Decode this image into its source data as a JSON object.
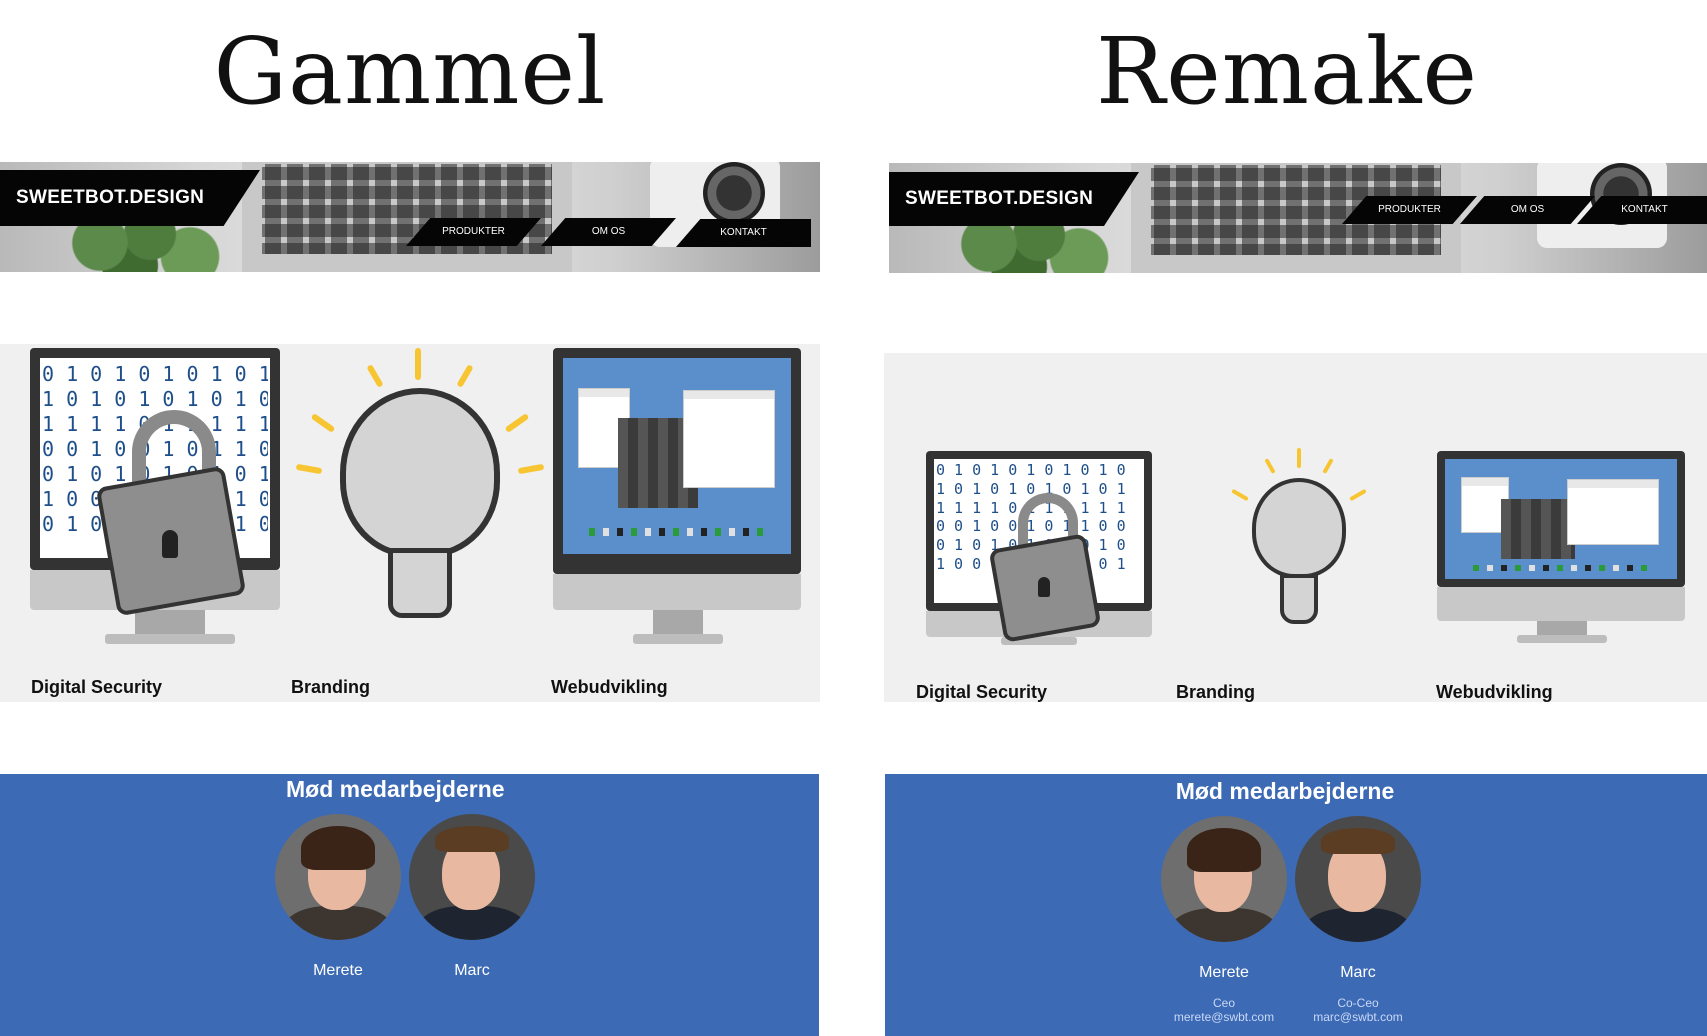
{
  "left": {
    "heading": "Gammel",
    "logo": "SWEETBOT.DESIGN",
    "nav": [
      "PRODUKTER",
      "OM OS",
      "KONTAKT"
    ],
    "services": [
      "Digital Security",
      "Branding",
      "Webudvikling"
    ],
    "team_title": "Mød medarbejderne",
    "members": [
      {
        "name": "Merete"
      },
      {
        "name": "Marc"
      }
    ]
  },
  "right": {
    "heading": "Remake",
    "logo": "SWEETBOT.DESIGN",
    "nav": [
      "PRODUKTER",
      "OM OS",
      "KONTAKT"
    ],
    "services": [
      "Digital Security",
      "Branding",
      "Webudvikling"
    ],
    "team_title": "Mød medarbejderne",
    "members": [
      {
        "name": "Merete",
        "role": "Ceo",
        "email": "merete@swbt.com"
      },
      {
        "name": "Marc",
        "role": "Co-Ceo",
        "email": "marc@swbt.com"
      }
    ]
  },
  "colors": {
    "team_background": "#3c6ab5",
    "services_background": "#f0f0f0",
    "nav_background": "#050505",
    "binary_digits": "#1e4f8a",
    "bulb_rays": "#f7c531"
  },
  "icons": [
    "padlock-icon",
    "lightbulb-icon",
    "desktop-monitor-icon"
  ]
}
